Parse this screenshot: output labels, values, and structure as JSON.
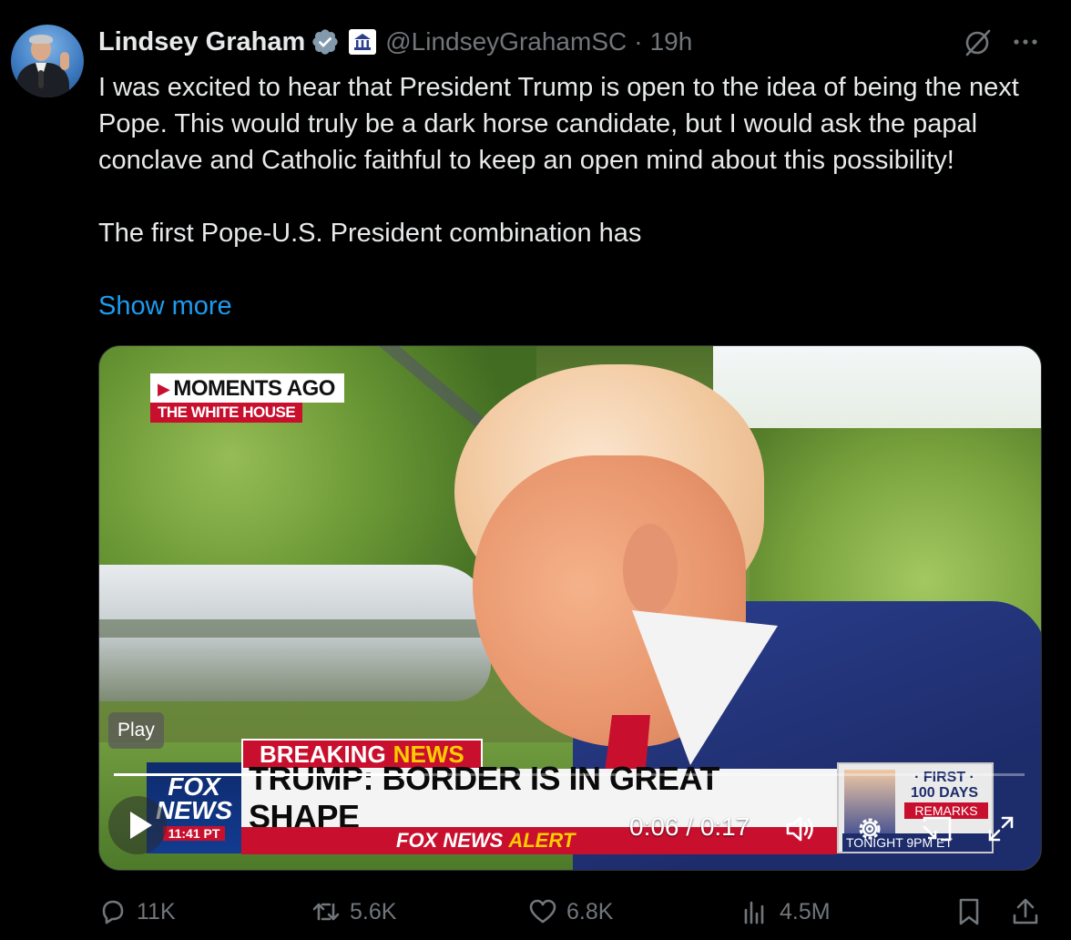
{
  "author": {
    "name": "Lindsey Graham",
    "handle": "@LindseyGrahamSC",
    "separator": "·",
    "time": "19h"
  },
  "tweet": {
    "text": "I was excited to hear that President Trump is open to the idea of being the next Pope. This would truly be a dark horse candidate, but I would ask the papal conclave and Catholic faithful to keep an open mind about this possibility!\n\nThe first Pope-U.S. President combination has",
    "show_more": "Show more"
  },
  "video": {
    "lower_third_top": "MOMENTS AGO",
    "lower_third_sub": "THE WHITE HOUSE",
    "breaking_label": "BREAKING",
    "breaking_news": "NEWS",
    "chyron": "TRUMP: BORDER IS IN GREAT SHAPE",
    "alert_left": "FOX NEWS",
    "alert_right": "ALERT",
    "logo_line1": "FOX",
    "logo_line2": "NEWS",
    "logo_time": "11:41 PT",
    "inset_first": "· FIRST ·",
    "inset_days": "100 DAYS",
    "inset_remarks": "REMARKS",
    "inset_tonight": "TONIGHT 9PM ET",
    "play_badge": "Play",
    "time_readout": "0:06 / 0:17",
    "progress_fraction": 0.33
  },
  "actions": {
    "replies": "11K",
    "reposts": "5.6K",
    "likes": "6.8K",
    "views": "4.5M"
  },
  "colors": {
    "background": "#000000",
    "text": "#e7e9ea",
    "muted": "#71767b",
    "link": "#1d9bf0",
    "fox_red": "#c8102e"
  },
  "icons": [
    "verified-badge-icon",
    "government-building-icon",
    "grok-icon",
    "more-icon",
    "play-icon",
    "volume-icon",
    "settings-icon",
    "cast-icon",
    "fullscreen-icon",
    "reply-icon",
    "repost-icon",
    "like-icon",
    "views-icon",
    "bookmark-icon",
    "share-icon"
  ]
}
